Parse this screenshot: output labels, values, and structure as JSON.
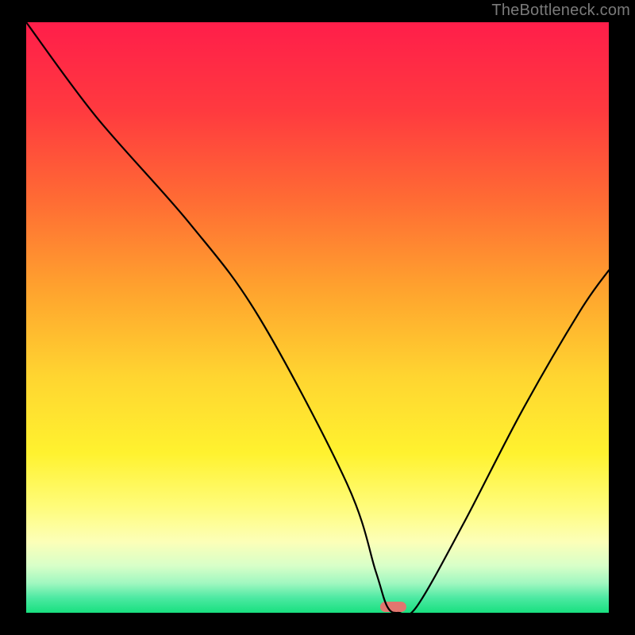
{
  "watermark": "TheBottleneck.com",
  "chart_data": {
    "type": "line",
    "title": "",
    "xlabel": "",
    "ylabel": "",
    "xlim": [
      0,
      100
    ],
    "ylim": [
      0,
      100
    ],
    "grid": false,
    "legend": false,
    "series": [
      {
        "name": "bottleneck-curve",
        "x": [
          0,
          12,
          28,
          40,
          55,
          60,
          62,
          64,
          67,
          75,
          85,
          95,
          100
        ],
        "y": [
          100,
          84,
          66,
          50,
          22,
          7,
          1,
          0,
          1,
          15,
          34,
          51,
          58
        ]
      }
    ],
    "background_gradient": {
      "stops": [
        {
          "pos": 0.0,
          "color": "#ff1e4a"
        },
        {
          "pos": 0.15,
          "color": "#ff3a3f"
        },
        {
          "pos": 0.3,
          "color": "#ff6b34"
        },
        {
          "pos": 0.45,
          "color": "#ffa22e"
        },
        {
          "pos": 0.6,
          "color": "#ffd530"
        },
        {
          "pos": 0.73,
          "color": "#fff22f"
        },
        {
          "pos": 0.82,
          "color": "#fffc7a"
        },
        {
          "pos": 0.88,
          "color": "#fcffb8"
        },
        {
          "pos": 0.92,
          "color": "#d8ffc8"
        },
        {
          "pos": 0.95,
          "color": "#a0f7c0"
        },
        {
          "pos": 0.975,
          "color": "#4ce9a2"
        },
        {
          "pos": 1.0,
          "color": "#18e07f"
        }
      ]
    },
    "optimal_marker": {
      "x_center": 63,
      "width_pct": 4.5,
      "color": "#e2766f"
    }
  }
}
